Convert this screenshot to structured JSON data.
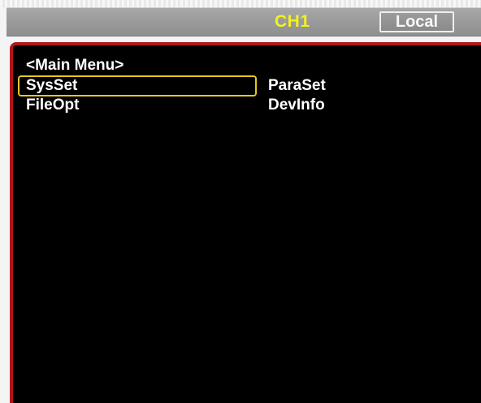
{
  "status_bar": {
    "channel": "CH1",
    "mode_button": "Local"
  },
  "menu": {
    "title": "<Main Menu>",
    "items": [
      {
        "label": "SysSet",
        "selected": true
      },
      {
        "label": "ParaSet",
        "selected": false
      },
      {
        "label": "FileOpt",
        "selected": false
      },
      {
        "label": "DevInfo",
        "selected": false
      }
    ]
  },
  "colors": {
    "channel_text": "#f2f21e",
    "panel_border": "#b0161a",
    "selection_highlight": "#e8c81a",
    "panel_background": "#000000"
  }
}
